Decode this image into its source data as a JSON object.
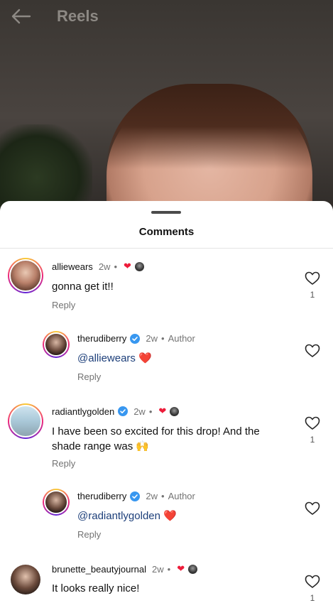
{
  "topbar": {
    "title": "Reels"
  },
  "sheet": {
    "title": "Comments"
  },
  "comments": [
    {
      "username": "alliewears",
      "time": "2w",
      "text": "gonna get it!!",
      "reply_label": "Reply",
      "likes": "1"
    },
    {
      "username": "therudiberry",
      "time": "2w",
      "author_label": "Author",
      "mention": "@alliewears",
      "emoji": "❤️",
      "reply_label": "Reply"
    },
    {
      "username": "radiantlygolden",
      "time": "2w",
      "text_line1": "I have been so excited for this drop! And the",
      "text_line2": "shade range was 🙌",
      "reply_label": "Reply",
      "likes": "1"
    },
    {
      "username": "therudiberry",
      "time": "2w",
      "author_label": "Author",
      "mention": "@radiantlygolden",
      "emoji": "❤️",
      "reply_label": "Reply"
    },
    {
      "username": "brunette_beautyjournal",
      "time": "2w",
      "text": "It looks really nice!",
      "likes": "1"
    }
  ],
  "colors": {
    "heart": "#ed1c3a",
    "verified": "#3897f0",
    "mention": "#1d3f7a"
  }
}
